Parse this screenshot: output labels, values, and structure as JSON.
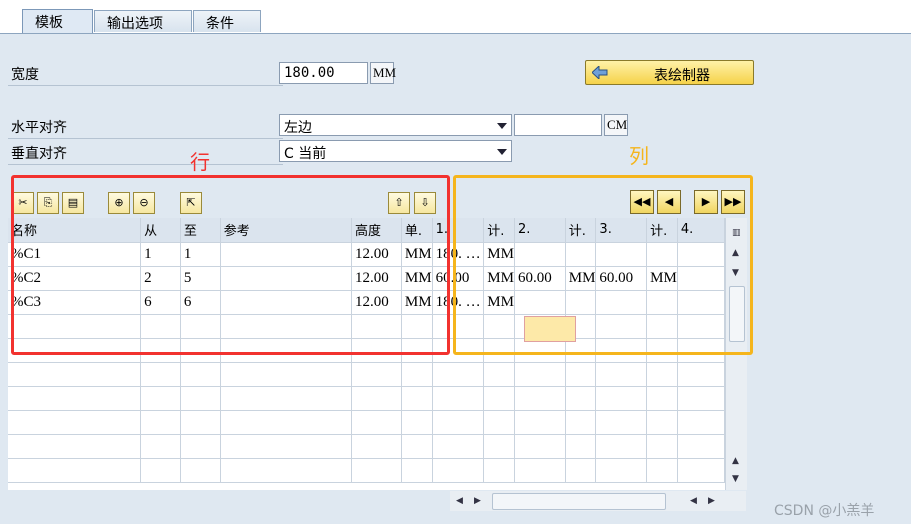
{
  "tabs": [
    {
      "label": "模板"
    },
    {
      "label": "输出选项"
    },
    {
      "label": "条件"
    }
  ],
  "form": {
    "width_label": "宽度",
    "width_value": "180.00",
    "width_unit": "MM",
    "painter_button": "表绘制器",
    "halign_label": "水平对齐",
    "halign_value": "左边",
    "halign_extra_value": "",
    "halign_unit": "CM",
    "valign_label": "垂直对齐",
    "valign_value": "C 当前"
  },
  "toolbar": {
    "icons": [
      "cut-icon",
      "copy-icon",
      "paste-icon",
      "insert-row-icon",
      "delete-row-icon",
      "split-icon"
    ],
    "right_icons": [
      "move-up-icon",
      "move-down-icon"
    ],
    "nav_icons": [
      "first-column-icon",
      "previous-column-icon",
      "next-column-icon",
      "last-column-icon"
    ]
  },
  "table": {
    "columns": [
      "名称",
      "从",
      "至",
      "参考",
      "高度",
      "单.",
      "1.",
      "计.",
      "2.",
      "计.",
      "3.",
      "计.",
      "4."
    ],
    "rows": [
      [
        "%C1",
        "1",
        "1",
        "",
        "12.00",
        "MM",
        "180. …",
        "MM",
        "",
        "",
        "",
        "",
        ""
      ],
      [
        "%C2",
        "2",
        "5",
        "",
        "12.00",
        "MM",
        "60.00",
        "MM",
        "60.00",
        "MM",
        "60.00",
        "MM",
        ""
      ],
      [
        "%C3",
        "6",
        "6",
        "",
        "12.00",
        "MM",
        "180. …",
        "MM",
        "",
        "",
        "",
        "",
        ""
      ]
    ]
  },
  "annotations": {
    "row_label": "行",
    "col_label": "列",
    "row_color": "#f2322f",
    "col_color": "#f5b51c"
  },
  "watermark": "CSDN @小羔羊"
}
